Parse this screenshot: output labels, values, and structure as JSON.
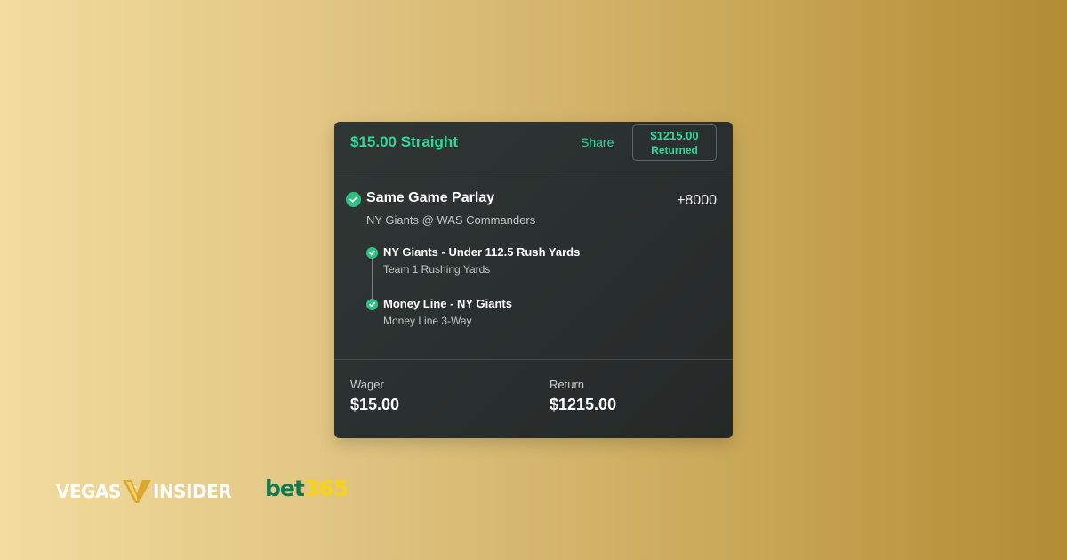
{
  "bet_slip": {
    "title": "$15.00 Straight",
    "share_label": "Share",
    "returned_amount": "$1215.00",
    "returned_label": "Returned",
    "parlay": {
      "name": "Same Game Parlay",
      "odds": "+8000",
      "matchup": "NY Giants @ WAS Commanders",
      "legs": [
        {
          "title": "NY Giants - Under 112.5 Rush Yards",
          "market": "Team 1 Rushing Yards"
        },
        {
          "title": "Money Line - NY Giants",
          "market": "Money Line 3-Way"
        }
      ]
    },
    "footer": {
      "wager_label": "Wager",
      "wager_value": "$15.00",
      "return_label": "Return",
      "return_value": "$1215.00"
    }
  },
  "branding": {
    "vegas_insider_logo": "VEGAS INSIDER",
    "bet365_logo": "bet365"
  },
  "colors": {
    "accent_green": "#2fd89b",
    "check_green": "#2fbf82",
    "card_background": "#2b3130",
    "bet365_green": "#0f7a4e",
    "bet365_yellow": "#f7d21a"
  },
  "icons": {
    "status_check": "check-circle-icon",
    "brand_mark": "vegas-insider-v-icon"
  }
}
